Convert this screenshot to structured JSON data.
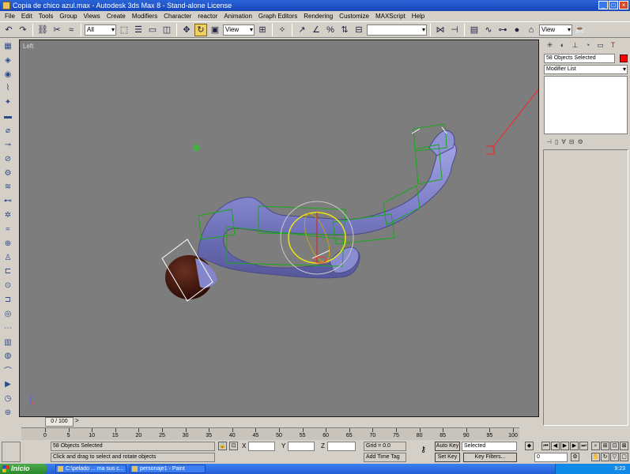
{
  "window": {
    "title": "Copia de chico azul.max - Autodesk 3ds Max 8 - Stand-alone License"
  },
  "menu": [
    "File",
    "Edit",
    "Tools",
    "Group",
    "Views",
    "Create",
    "Modifiers",
    "Character",
    "reactor",
    "Animation",
    "Graph Editors",
    "Rendering",
    "Customize",
    "MAXScript",
    "Help"
  ],
  "toolbar": {
    "filter_value": "All",
    "refcoord_value": "View",
    "named_sel_value": "",
    "view_value": "View"
  },
  "viewport": {
    "label": "Left",
    "background": "#7d7d7d"
  },
  "command_panel": {
    "selection_text": "58 Objects Selected",
    "modifier_list": "Modifier List",
    "color": "#ff0000"
  },
  "timeslider": {
    "frame_text": "0 / 100",
    "prev": "<",
    "next": ">"
  },
  "trackbar": {
    "ticks": [
      "0",
      "5",
      "10",
      "15",
      "20",
      "25",
      "30",
      "35",
      "40",
      "45",
      "50",
      "55",
      "60",
      "65",
      "70",
      "75",
      "80",
      "85",
      "90",
      "95",
      "100"
    ]
  },
  "status": {
    "selected_text": "58 Objects Selected",
    "prompt_text": "Click and drag to select and rotate objects",
    "x_label": "X",
    "x_value": "",
    "y_label": "Y",
    "y_value": "",
    "z_label": "Z",
    "z_value": "",
    "grid_text": "Grid = 0.0",
    "add_time_tag": "Add Time Tag",
    "auto_key": "Auto Key",
    "set_key": "Set Key",
    "selected_dropdown": "Selected",
    "key_filters": "Key Filters...",
    "frame_value": "0"
  },
  "taskbar": {
    "start": "Inicio",
    "tasks": [
      "C:\\pelado ... ma sus c...",
      "personaje1 - Paint"
    ],
    "clock": "9:23"
  }
}
